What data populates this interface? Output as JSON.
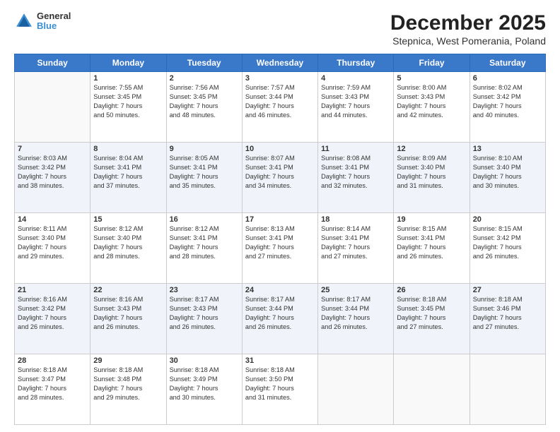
{
  "logo": {
    "line1": "General",
    "line2": "Blue"
  },
  "title": "December 2025",
  "subtitle": "Stepnica, West Pomerania, Poland",
  "days_header": [
    "Sunday",
    "Monday",
    "Tuesday",
    "Wednesday",
    "Thursday",
    "Friday",
    "Saturday"
  ],
  "weeks": [
    [
      {
        "day": "",
        "text": ""
      },
      {
        "day": "1",
        "text": "Sunrise: 7:55 AM\nSunset: 3:45 PM\nDaylight: 7 hours\nand 50 minutes."
      },
      {
        "day": "2",
        "text": "Sunrise: 7:56 AM\nSunset: 3:45 PM\nDaylight: 7 hours\nand 48 minutes."
      },
      {
        "day": "3",
        "text": "Sunrise: 7:57 AM\nSunset: 3:44 PM\nDaylight: 7 hours\nand 46 minutes."
      },
      {
        "day": "4",
        "text": "Sunrise: 7:59 AM\nSunset: 3:43 PM\nDaylight: 7 hours\nand 44 minutes."
      },
      {
        "day": "5",
        "text": "Sunrise: 8:00 AM\nSunset: 3:43 PM\nDaylight: 7 hours\nand 42 minutes."
      },
      {
        "day": "6",
        "text": "Sunrise: 8:02 AM\nSunset: 3:42 PM\nDaylight: 7 hours\nand 40 minutes."
      }
    ],
    [
      {
        "day": "7",
        "text": "Sunrise: 8:03 AM\nSunset: 3:42 PM\nDaylight: 7 hours\nand 38 minutes."
      },
      {
        "day": "8",
        "text": "Sunrise: 8:04 AM\nSunset: 3:41 PM\nDaylight: 7 hours\nand 37 minutes."
      },
      {
        "day": "9",
        "text": "Sunrise: 8:05 AM\nSunset: 3:41 PM\nDaylight: 7 hours\nand 35 minutes."
      },
      {
        "day": "10",
        "text": "Sunrise: 8:07 AM\nSunset: 3:41 PM\nDaylight: 7 hours\nand 34 minutes."
      },
      {
        "day": "11",
        "text": "Sunrise: 8:08 AM\nSunset: 3:41 PM\nDaylight: 7 hours\nand 32 minutes."
      },
      {
        "day": "12",
        "text": "Sunrise: 8:09 AM\nSunset: 3:40 PM\nDaylight: 7 hours\nand 31 minutes."
      },
      {
        "day": "13",
        "text": "Sunrise: 8:10 AM\nSunset: 3:40 PM\nDaylight: 7 hours\nand 30 minutes."
      }
    ],
    [
      {
        "day": "14",
        "text": "Sunrise: 8:11 AM\nSunset: 3:40 PM\nDaylight: 7 hours\nand 29 minutes."
      },
      {
        "day": "15",
        "text": "Sunrise: 8:12 AM\nSunset: 3:40 PM\nDaylight: 7 hours\nand 28 minutes."
      },
      {
        "day": "16",
        "text": "Sunrise: 8:12 AM\nSunset: 3:41 PM\nDaylight: 7 hours\nand 28 minutes."
      },
      {
        "day": "17",
        "text": "Sunrise: 8:13 AM\nSunset: 3:41 PM\nDaylight: 7 hours\nand 27 minutes."
      },
      {
        "day": "18",
        "text": "Sunrise: 8:14 AM\nSunset: 3:41 PM\nDaylight: 7 hours\nand 27 minutes."
      },
      {
        "day": "19",
        "text": "Sunrise: 8:15 AM\nSunset: 3:41 PM\nDaylight: 7 hours\nand 26 minutes."
      },
      {
        "day": "20",
        "text": "Sunrise: 8:15 AM\nSunset: 3:42 PM\nDaylight: 7 hours\nand 26 minutes."
      }
    ],
    [
      {
        "day": "21",
        "text": "Sunrise: 8:16 AM\nSunset: 3:42 PM\nDaylight: 7 hours\nand 26 minutes."
      },
      {
        "day": "22",
        "text": "Sunrise: 8:16 AM\nSunset: 3:43 PM\nDaylight: 7 hours\nand 26 minutes."
      },
      {
        "day": "23",
        "text": "Sunrise: 8:17 AM\nSunset: 3:43 PM\nDaylight: 7 hours\nand 26 minutes."
      },
      {
        "day": "24",
        "text": "Sunrise: 8:17 AM\nSunset: 3:44 PM\nDaylight: 7 hours\nand 26 minutes."
      },
      {
        "day": "25",
        "text": "Sunrise: 8:17 AM\nSunset: 3:44 PM\nDaylight: 7 hours\nand 26 minutes."
      },
      {
        "day": "26",
        "text": "Sunrise: 8:18 AM\nSunset: 3:45 PM\nDaylight: 7 hours\nand 27 minutes."
      },
      {
        "day": "27",
        "text": "Sunrise: 8:18 AM\nSunset: 3:46 PM\nDaylight: 7 hours\nand 27 minutes."
      }
    ],
    [
      {
        "day": "28",
        "text": "Sunrise: 8:18 AM\nSunset: 3:47 PM\nDaylight: 7 hours\nand 28 minutes."
      },
      {
        "day": "29",
        "text": "Sunrise: 8:18 AM\nSunset: 3:48 PM\nDaylight: 7 hours\nand 29 minutes."
      },
      {
        "day": "30",
        "text": "Sunrise: 8:18 AM\nSunset: 3:49 PM\nDaylight: 7 hours\nand 30 minutes."
      },
      {
        "day": "31",
        "text": "Sunrise: 8:18 AM\nSunset: 3:50 PM\nDaylight: 7 hours\nand 31 minutes."
      },
      {
        "day": "",
        "text": ""
      },
      {
        "day": "",
        "text": ""
      },
      {
        "day": "",
        "text": ""
      }
    ]
  ]
}
